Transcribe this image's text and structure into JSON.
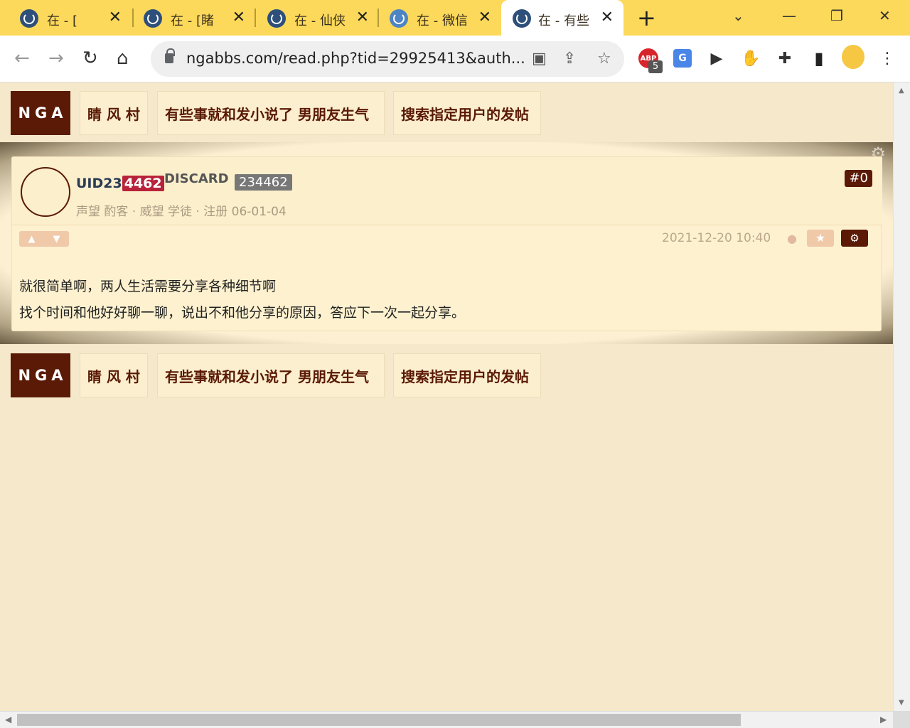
{
  "browser": {
    "tabs": [
      {
        "title": "在 - [",
        "suffix": "]"
      },
      {
        "title": "在 - [睹",
        "suffix": ""
      },
      {
        "title": "在 - 仙侠",
        "suffix": ""
      },
      {
        "title": "在 - 微信",
        "suffix": ""
      },
      {
        "title": "在 - 有些",
        "suffix": ""
      }
    ],
    "new_tab": "+",
    "url": "ngabbs.com/read.php?tid=29925413&auth...",
    "abp_label": "ABP",
    "abp_count": "5",
    "translate_label": "G"
  },
  "nav_top": {
    "logo": "NGA",
    "forum": "睛 风 村",
    "thread": "有些事就和发小说了 男朋友生气",
    "search_user": "搜索指定用户的发帖"
  },
  "post": {
    "username_prefix": "UID23",
    "username_highlight": "4462",
    "username_tag": "DISCARD",
    "uid_badge": "234462",
    "meta": "声望 酌客 · 威望 学徒 · 注册 06-01-04",
    "floor": "#0",
    "time": "2021-12-20 10:40",
    "star": "★",
    "gear": "⚙",
    "lines": [
      "就很简单啊，两人生活需要分享各种细节啊",
      "找个时间和他好好聊一聊，说出不和他分享的原因，答应下一次一起分享。"
    ]
  },
  "nav_bottom": {
    "logo": "NGA",
    "forum": "睛 风 村",
    "thread": "有些事就和发小说了 男朋友生气",
    "search_user": "搜索指定用户的发帖"
  },
  "colors": {
    "tab_bar": "#fcd95a",
    "page_bg": "#f6e8ca",
    "brand": "#5a1a05",
    "highlight": "#b8223a"
  }
}
